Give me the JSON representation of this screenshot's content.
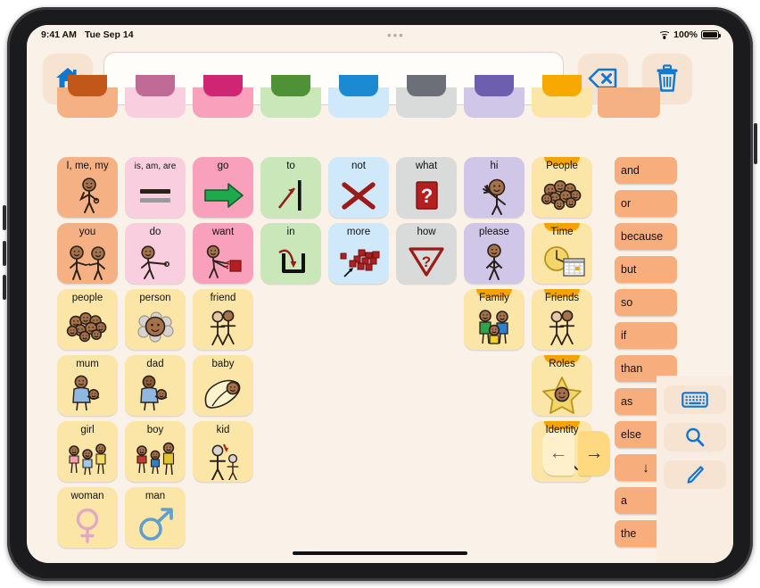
{
  "status_bar": {
    "time": "9:41 AM",
    "date": "Tue Sep 14",
    "battery": "100%",
    "wifi_icon": "wifi-icon",
    "battery_icon": "battery-icon",
    "dots": "•••"
  },
  "toolbar": {
    "home_icon": "home-icon",
    "backspace_icon": "backspace-icon",
    "trash_icon": "trash-icon",
    "message_text": "",
    "message_placeholder": ""
  },
  "colors": {
    "pronoun": "#f5b183",
    "verb_pink": "#f9cfe0",
    "verb_deep": "#f9a0bd",
    "prep_green": "#c9e7b8",
    "negation_blue": "#cfe9fa",
    "question_grey": "#d9dada",
    "social_purple": "#cfc6e8",
    "noun_yellow": "#fbe6a7",
    "connector": "#f7ae7c",
    "tab_orange": "#f5a300",
    "accent_blue": "#0f77d0"
  },
  "grid": {
    "stubs": [
      {
        "fill": "#f5b183",
        "tab": "#c2571a"
      },
      {
        "fill": "#f9cfe0",
        "tab": "#c06b96"
      },
      {
        "fill": "#f9a0bd",
        "tab": "#cf2573"
      },
      {
        "fill": "#c9e7b8",
        "tab": "#4e9136"
      },
      {
        "fill": "#cfe9fa",
        "tab": "#1c8ad3"
      },
      {
        "fill": "#d9dada",
        "tab": "#6b6f78"
      },
      {
        "fill": "#cfc6e8",
        "tab": "#6e5fae"
      },
      {
        "fill": "#fbe6a7",
        "tab": "#f7a900"
      },
      {
        "fill": "#f5b183",
        "tab": "#e07a26"
      }
    ],
    "rows": [
      [
        {
          "label": "I, me, my",
          "icon": "person-pointing-self-icon",
          "fill": "#f5b183",
          "folder": false
        },
        {
          "label": "is, am, are",
          "icon": "equals-sign-icon",
          "fill": "#f9cfe0",
          "folder": false
        },
        {
          "label": "go",
          "icon": "green-arrow-right-icon",
          "fill": "#f9a0bd",
          "folder": false
        },
        {
          "label": "to",
          "icon": "arrow-to-line-icon",
          "fill": "#c9e7b8",
          "folder": false
        },
        {
          "label": "not",
          "icon": "red-cross-icon",
          "fill": "#cfe9fa",
          "folder": false
        },
        {
          "label": "what",
          "icon": "red-question-box-icon",
          "fill": "#d9dada",
          "folder": false
        },
        {
          "label": "hi",
          "icon": "person-waving-icon",
          "fill": "#cfc6e8",
          "folder": false
        },
        {
          "label": "People",
          "icon": "crowd-of-faces-icon",
          "fill": "#fbe6a7",
          "folder": true
        }
      ],
      [
        {
          "label": "you",
          "icon": "two-people-pointing-icon",
          "fill": "#f5b183",
          "folder": false
        },
        {
          "label": "do",
          "icon": "person-reaching-icon",
          "fill": "#f9cfe0",
          "folder": false
        },
        {
          "label": "want",
          "icon": "person-wanting-block-icon",
          "fill": "#f9a0bd",
          "folder": false
        },
        {
          "label": "in",
          "icon": "arrow-into-container-icon",
          "fill": "#c9e7b8",
          "folder": false
        },
        {
          "label": "more",
          "icon": "red-blocks-pile-icon",
          "fill": "#cfe9fa",
          "folder": false
        },
        {
          "label": "how",
          "icon": "red-question-triangle-icon",
          "fill": "#d9dada",
          "folder": false
        },
        {
          "label": "please",
          "icon": "person-please-icon",
          "fill": "#cfc6e8",
          "folder": false
        },
        {
          "label": "Time",
          "icon": "clock-calendar-icon",
          "fill": "#fbe6a7",
          "folder": true
        }
      ],
      [
        {
          "label": "people",
          "icon": "crowd-of-faces-icon",
          "fill": "#fbe6a7",
          "folder": false
        },
        {
          "label": "person",
          "icon": "single-face-in-crowd-icon",
          "fill": "#fbe6a7",
          "folder": false
        },
        {
          "label": "friend",
          "icon": "two-friends-icon",
          "fill": "#fbe6a7",
          "folder": false
        },
        {
          "label": "Family",
          "icon": "family-group-icon",
          "fill": "#fbe6a7",
          "folder": true,
          "col": 6
        },
        {
          "label": "Friends",
          "icon": "two-friends-icon",
          "fill": "#fbe6a7",
          "folder": true,
          "col": 7
        }
      ],
      [
        {
          "label": "mum",
          "icon": "woman-holding-baby-icon",
          "fill": "#fbe6a7",
          "folder": false
        },
        {
          "label": "dad",
          "icon": "man-holding-baby-icon",
          "fill": "#fbe6a7",
          "folder": false
        },
        {
          "label": "baby",
          "icon": "swaddled-baby-icon",
          "fill": "#fbe6a7",
          "folder": false
        },
        {
          "label": "Roles",
          "icon": "star-face-icon",
          "fill": "#fbe6a7",
          "folder": true,
          "col": 7
        }
      ],
      [
        {
          "label": "girl",
          "icon": "three-girls-icon",
          "fill": "#fbe6a7",
          "folder": false
        },
        {
          "label": "boy",
          "icon": "three-boys-icon",
          "fill": "#fbe6a7",
          "folder": false
        },
        {
          "label": "kid",
          "icon": "adult-and-child-icon",
          "fill": "#fbe6a7",
          "folder": false
        },
        {
          "label": "Identity",
          "icon": "person-green-shirt-icon",
          "fill": "#fbe6a7",
          "folder": true,
          "col": 7
        }
      ],
      [
        {
          "label": "woman",
          "icon": "female-symbol-icon",
          "fill": "#fbe6a7",
          "folder": false
        },
        {
          "label": "man",
          "icon": "male-symbol-icon",
          "fill": "#fbe6a7",
          "folder": false
        }
      ]
    ]
  },
  "word_column": [
    {
      "label": "and",
      "type": "text"
    },
    {
      "label": "or",
      "type": "text"
    },
    {
      "label": "because",
      "type": "text"
    },
    {
      "label": "but",
      "type": "text"
    },
    {
      "label": "so",
      "type": "text"
    },
    {
      "label": "if",
      "type": "text"
    },
    {
      "label": "than",
      "type": "text"
    },
    {
      "label": "as",
      "type": "text"
    },
    {
      "label": "else",
      "type": "text"
    },
    {
      "label": "↓",
      "type": "icon",
      "icon_name": "arrow-down-icon"
    },
    {
      "label": "a",
      "type": "text"
    },
    {
      "label": "the",
      "type": "text"
    }
  ],
  "navigation": {
    "prev_label": "←",
    "prev_icon": "arrow-left-icon",
    "next_label": "→",
    "next_icon": "arrow-right-icon"
  },
  "side_tools": [
    {
      "name": "keyboard-button",
      "icon": "keyboard-icon"
    },
    {
      "name": "search-button",
      "icon": "search-icon"
    },
    {
      "name": "edit-button",
      "icon": "pencil-icon"
    }
  ]
}
